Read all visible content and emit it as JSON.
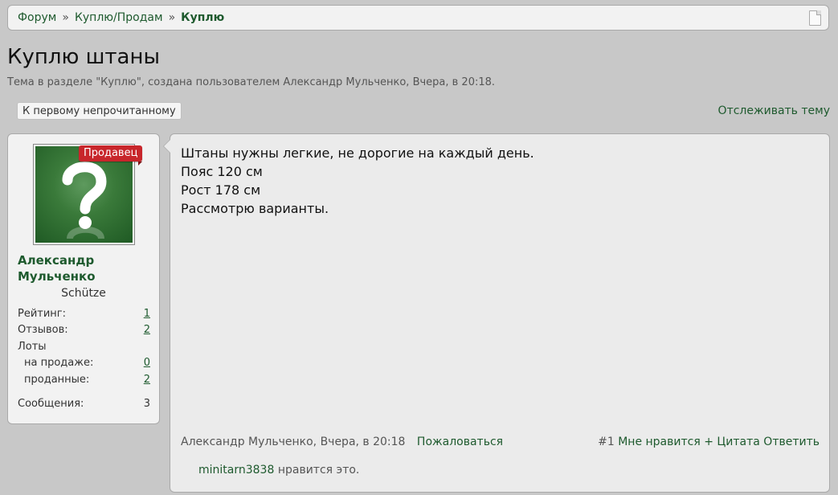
{
  "breadcrumb": {
    "items": [
      "Форум",
      "Куплю/Продам"
    ],
    "separator": "»",
    "current": "Куплю"
  },
  "thread": {
    "title": "Куплю штаны",
    "subtitle": "Тема в разделе \"Куплю\", создана пользователем Александр Мульченко, Вчера, в 20:18.",
    "unread_button": "К первому непрочитанному",
    "watch_link": "Отслеживать тему"
  },
  "user": {
    "badge": "Продавец",
    "name": "Александр Мульченко",
    "title": "Schütze",
    "avatar_icon": "question-mark-icon",
    "stats": {
      "rating_label": "Рейтинг:",
      "rating_value": "1",
      "reviews_label": "Отзывов:",
      "reviews_value": "2",
      "lots_label": "Лоты",
      "on_sale_label": "на продаже:",
      "on_sale_value": "0",
      "sold_label": "проданные:",
      "sold_value": "2",
      "messages_label": "Сообщения:",
      "messages_value": "3"
    }
  },
  "post": {
    "lines": [
      "Штаны нужны легкие, не дорогие на каждый день.",
      "Пояс 120 см",
      "Рост 178 см",
      "Рассмотрю варианты."
    ],
    "meta": "Александр Мульченко, Вчера, в 20:18",
    "report": "Пожаловаться",
    "number": "#1",
    "like": "Мне нравится",
    "quote": "+ Цитата",
    "reply": "Ответить",
    "likes_user": "minitarn3838",
    "likes_text": " нравится это."
  },
  "colors": {
    "accent": "#1e5a2e",
    "badge": "#c8262b",
    "background": "#c8c8c8",
    "panel": "#f2f2f2"
  }
}
